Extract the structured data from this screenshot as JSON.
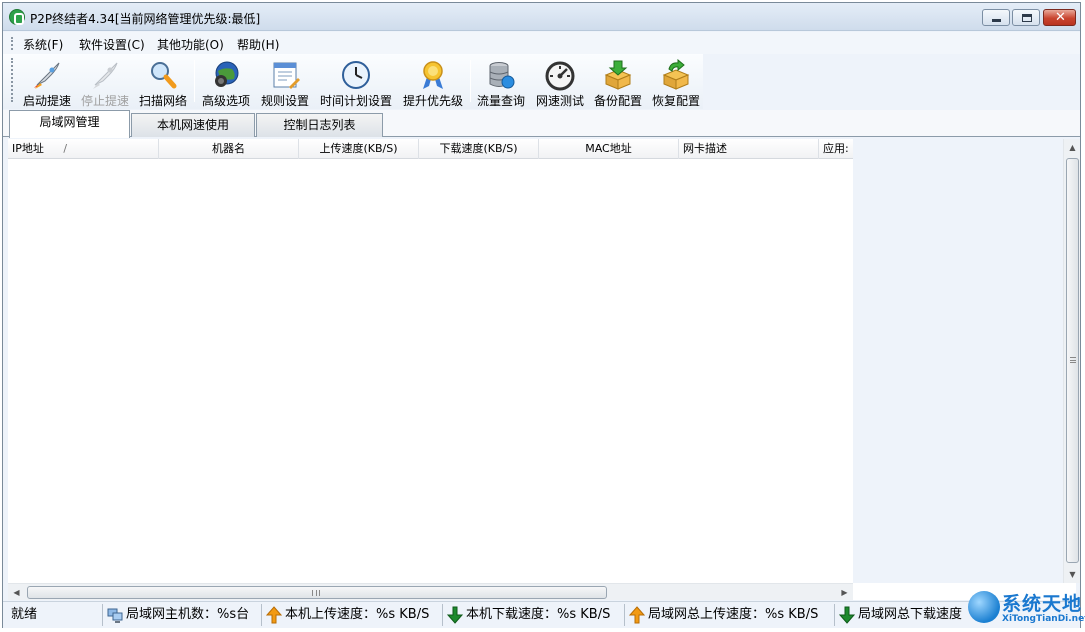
{
  "window": {
    "title": "P2P终结者4.34[当前网络管理优先级:最低]",
    "controls": {
      "minimize_icon": "minimize-icon",
      "maximize_icon": "maximize-icon",
      "close_icon": "close-icon"
    }
  },
  "menu": {
    "items": [
      {
        "label": "系统(F)"
      },
      {
        "label": "软件设置(C)"
      },
      {
        "label": "其他功能(O)"
      },
      {
        "label": "帮助(H)"
      }
    ]
  },
  "toolbar": {
    "buttons": [
      {
        "label": "启动提速",
        "icon": "rocket-icon",
        "enabled": true
      },
      {
        "label": "停止提速",
        "icon": "rocket-disabled-icon",
        "enabled": false
      },
      {
        "label": "扫描网络",
        "icon": "magnifier-icon",
        "enabled": true
      },
      {
        "label": "高级选项",
        "icon": "globe-camera-icon",
        "enabled": true
      },
      {
        "label": "规则设置",
        "icon": "rules-document-icon",
        "enabled": true
      },
      {
        "label": "时间计划设置",
        "icon": "clock-icon",
        "enabled": true
      },
      {
        "label": "提升优先级",
        "icon": "medal-icon",
        "enabled": true
      },
      {
        "label": "流量查询",
        "icon": "database-icon",
        "enabled": true
      },
      {
        "label": "网速测试",
        "icon": "speedometer-icon",
        "enabled": true
      },
      {
        "label": "备份配置",
        "icon": "box-download-icon",
        "enabled": true
      },
      {
        "label": "恢复配置",
        "icon": "box-restore-icon",
        "enabled": true
      }
    ]
  },
  "tabs": [
    {
      "label": "局域网管理",
      "active": true
    },
    {
      "label": "本机网速使用",
      "active": false
    },
    {
      "label": "控制日志列表",
      "active": false
    }
  ],
  "table": {
    "columns": [
      {
        "label": "IP地址",
        "sort_indicator": "/"
      },
      {
        "label": "机器名"
      },
      {
        "label": "上传速度(KB/S)"
      },
      {
        "label": "下载速度(KB/S)"
      },
      {
        "label": "MAC地址"
      },
      {
        "label": "网卡描述"
      },
      {
        "label": "应用:"
      }
    ],
    "rows": []
  },
  "statusbar": {
    "status": "就绪",
    "host_count": "局域网主机数：%s台",
    "local_upload": "本机上传速度：%s KB/S",
    "local_download": "本机下载速度：%s KB/S",
    "lan_upload": "局域网总上传速度：%s KB/S",
    "lan_download": "局域网总下载速度"
  },
  "watermark": {
    "title": "系统天地",
    "subtitle": "XiTongTianDi.net"
  },
  "colors": {
    "accent_blue": "#1a78cf",
    "arrow_up": "#f29a13",
    "arrow_down": "#1e8a2e",
    "close_button": "#c9452f"
  }
}
